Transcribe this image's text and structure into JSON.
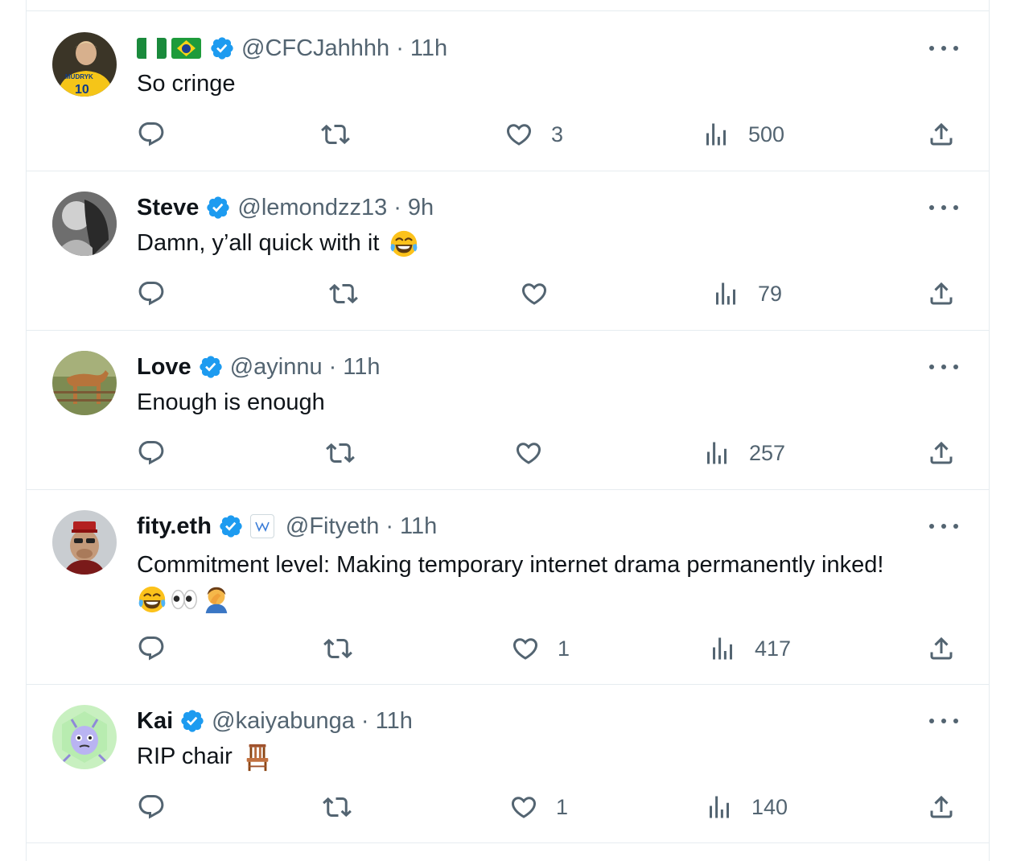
{
  "tweets": [
    {
      "name": "",
      "handle": "@CFCJahhhh",
      "time": "11h",
      "text": "So cringe",
      "likes": "3",
      "views": "500",
      "avatar_jersey": "MUDRYK",
      "flags": [
        "nigeria-flag",
        "brazil-flag"
      ]
    },
    {
      "name": "Steve",
      "handle": "@lemondzz13",
      "time": "9h",
      "text": "Damn, y’all quick with it",
      "likes": "",
      "views": "79",
      "emojis": [
        "tears-of-joy-emoji"
      ]
    },
    {
      "name": "Love",
      "handle": "@ayinnu",
      "time": "11h",
      "text": "Enough is enough",
      "likes": "",
      "views": "257"
    },
    {
      "name": "fity.eth",
      "handle": "@Fityeth",
      "time": "11h",
      "text": "Commitment level: Making temporary internet drama permanently inked!",
      "likes": "1",
      "views": "417",
      "emojis": [
        "tears-of-joy-emoji",
        "eyes-emoji",
        "facepalm-emoji"
      ]
    },
    {
      "name": "Kai",
      "handle": "@kaiyabunga",
      "time": "11h",
      "text": "RIP chair",
      "likes": "1",
      "views": "140",
      "emojis": [
        "chair-emoji"
      ]
    }
  ],
  "separator": "·",
  "colors": {
    "verified": "#1d9bf0",
    "secondary_text": "#536471",
    "primary_text": "#0f1419",
    "border": "#e6ecf0"
  }
}
